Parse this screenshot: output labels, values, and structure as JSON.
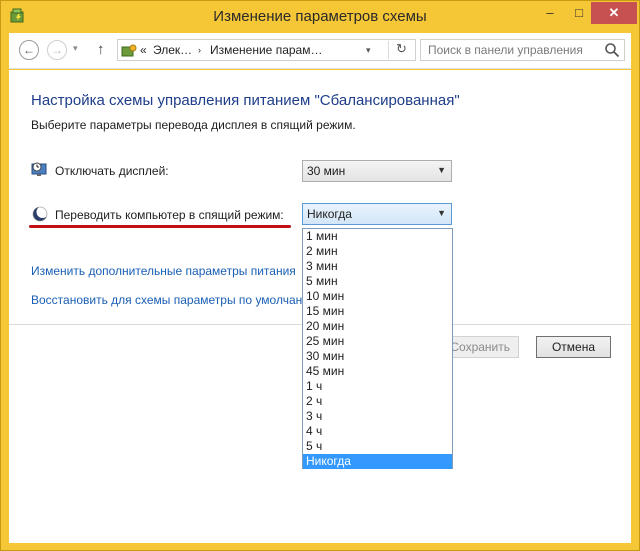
{
  "window": {
    "title": "Изменение параметров схемы",
    "minimize": "–",
    "maximize": "□",
    "close": "✕"
  },
  "navbar": {
    "back": "←",
    "forward": "→",
    "dropdown": "▾",
    "up": "↑",
    "breadcrumb": [
      "«",
      "Элек…",
      "›",
      "Изменение парам…"
    ],
    "address_dropdown": "▾",
    "refresh": "↻",
    "search_placeholder": "Поиск в панели управления",
    "search_icon": "magnifier-icon"
  },
  "main": {
    "title": "Настройка схемы управления питанием \"Сбалансированная\"",
    "subtitle": "Выберите параметры перевода дисплея в спящий режим.",
    "display_off": {
      "label": "Отключать дисплей:",
      "value": "30 мин",
      "icon": "monitor-clock-icon"
    },
    "sleep": {
      "label": "Переводить компьютер в спящий режим:",
      "value": "Никогда",
      "icon": "moon-icon"
    },
    "links": [
      "Изменить дополнительные параметры питания",
      "Восстановить для схемы параметры по умолчанию"
    ],
    "buttons": {
      "save": "Сохранить изменения",
      "cancel": "Отмена"
    }
  },
  "sleep_options": [
    "1 мин",
    "2 мин",
    "3 мин",
    "5 мин",
    "10 мин",
    "15 мин",
    "20 мин",
    "25 мин",
    "30 мин",
    "45 мин",
    "1 ч",
    "2 ч",
    "3 ч",
    "4 ч",
    "5 ч",
    "Никогда"
  ],
  "sleep_selected_index": 15,
  "colors": {
    "titlebar": "#f5c636",
    "close_button": "#c75050",
    "link": "#1a5fb4",
    "heading": "#1e3d8a",
    "underline": "#c00f17",
    "selection": "#3399ff"
  }
}
